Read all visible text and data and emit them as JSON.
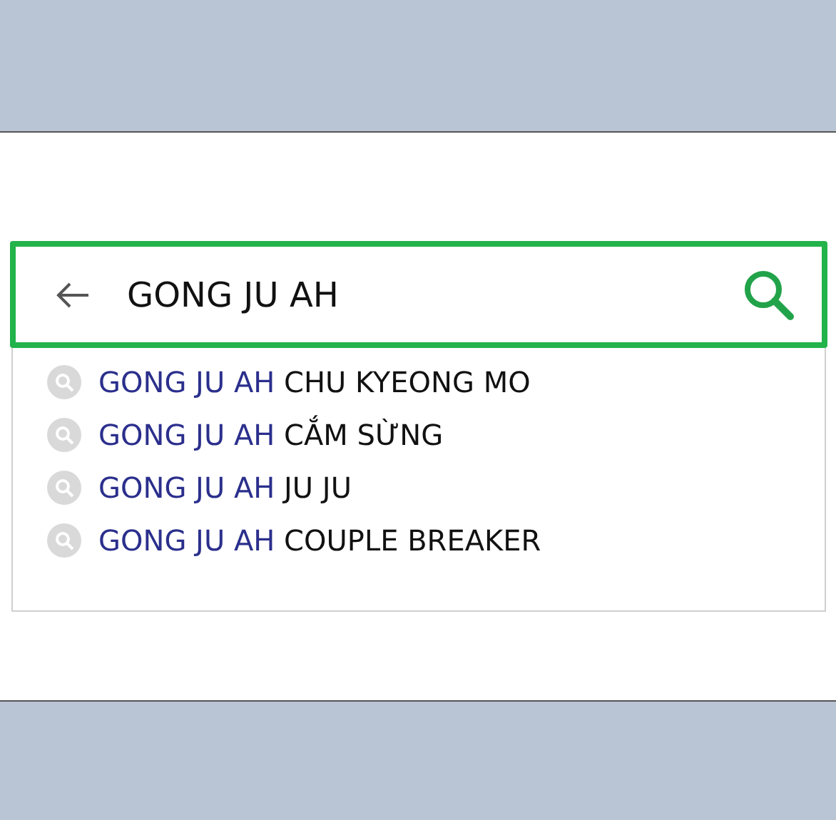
{
  "search": {
    "value": "GONG JU AH"
  },
  "suggestions": [
    {
      "match": "GONG JU AH",
      "rest": "CHU KYEONG MO"
    },
    {
      "match": "GONG JU AH",
      "rest": "CẮM SỪNG"
    },
    {
      "match": "GONG JU AH",
      "rest": "JU JU"
    },
    {
      "match": "GONG JU AH",
      "rest": "COUPLE BREAKER"
    }
  ]
}
